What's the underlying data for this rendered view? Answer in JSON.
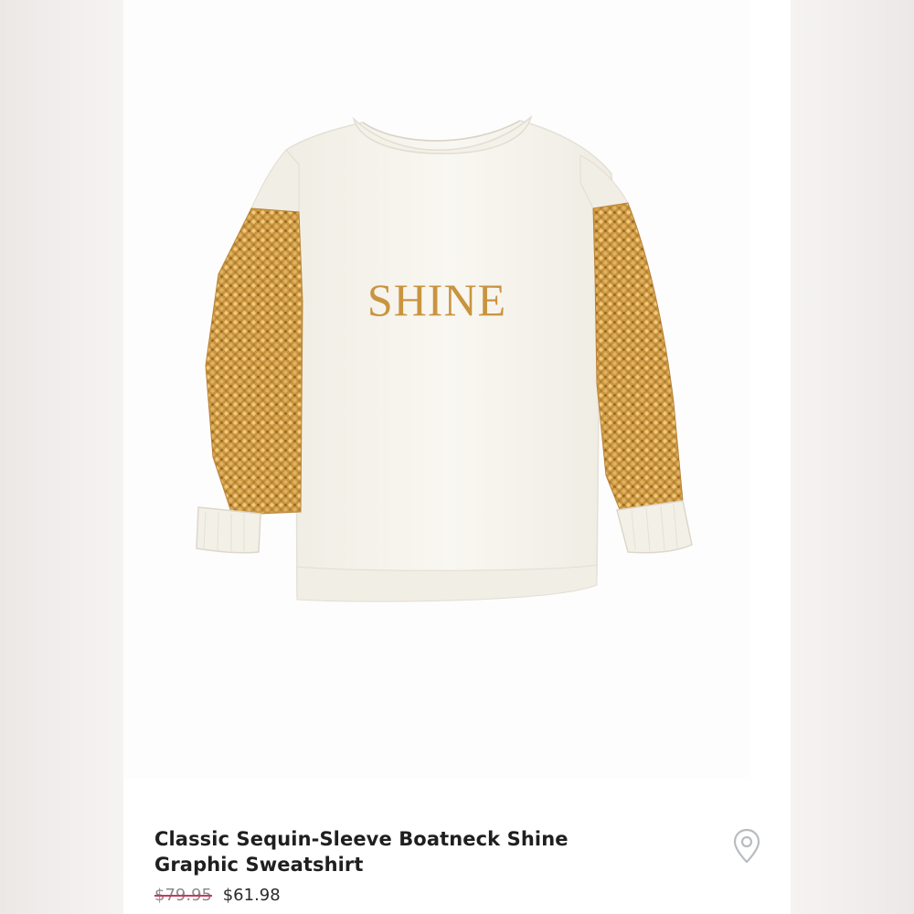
{
  "product": {
    "title": "Classic Sequin-Sleeve Boatneck Shine Graphic Sweatshirt",
    "original_price": "$79.95",
    "sale_price": "$61.98",
    "graphic_text": "SHINE"
  },
  "icons": {
    "location": "location-pin-icon"
  },
  "colors": {
    "sweatshirt": "#f7f4ec",
    "sequin_gold": "#c9943f",
    "strike_red": "#c93a57",
    "title_text": "#1f1f1f"
  }
}
